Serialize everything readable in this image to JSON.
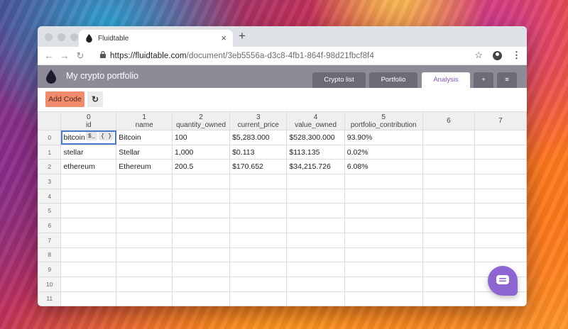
{
  "browser": {
    "tab_title": "Fluidtable",
    "tab_close": "×",
    "new_tab": "+",
    "url_domain": "https://fluidtable.com",
    "url_path": "/document/3eb5556a-d3c8-4fb1-864f-98d21fbcf8f4"
  },
  "app": {
    "title": "My crypto portfolio",
    "tabs": [
      {
        "label": "Crypto list"
      },
      {
        "label": "Portfolio"
      },
      {
        "label": "Analysis"
      },
      {
        "label": "+"
      },
      {
        "label": "≡"
      }
    ],
    "active_tab": "Analysis",
    "add_code_label": "Add Code",
    "refresh_icon": "↻"
  },
  "grid": {
    "columns": [
      {
        "num": "0",
        "name": "id"
      },
      {
        "num": "1",
        "name": "name"
      },
      {
        "num": "2",
        "name": "quantity_owned"
      },
      {
        "num": "3",
        "name": "current_price"
      },
      {
        "num": "4",
        "name": "value_owned"
      },
      {
        "num": "5",
        "name": "portfolio_contribution"
      },
      {
        "num": "6",
        "name": ""
      },
      {
        "num": "7",
        "name": ""
      }
    ],
    "rows": [
      {
        "num": "0",
        "cells": [
          "bitcoin",
          "Bitcoin",
          "100",
          "$5,283.000",
          "$528,300.000",
          "93.90%",
          "",
          ""
        ]
      },
      {
        "num": "1",
        "cells": [
          "stellar",
          "Stellar",
          "1,000",
          "$0.113",
          "$113.135",
          "0.02%",
          "",
          ""
        ]
      },
      {
        "num": "2",
        "cells": [
          "ethereum",
          "Ethereum",
          "200.5",
          "$170.652",
          "$34,215.726",
          "6.08%",
          "",
          ""
        ]
      },
      {
        "num": "3",
        "cells": [
          "",
          "",
          "",
          "",
          "",
          "",
          "",
          ""
        ]
      },
      {
        "num": "4",
        "cells": [
          "",
          "",
          "",
          "",
          "",
          "",
          "",
          ""
        ]
      },
      {
        "num": "5",
        "cells": [
          "",
          "",
          "",
          "",
          "",
          "",
          "",
          ""
        ]
      },
      {
        "num": "6",
        "cells": [
          "",
          "",
          "",
          "",
          "",
          "",
          "",
          ""
        ]
      },
      {
        "num": "7",
        "cells": [
          "",
          "",
          "",
          "",
          "",
          "",
          "",
          ""
        ]
      },
      {
        "num": "8",
        "cells": [
          "",
          "",
          "",
          "",
          "",
          "",
          "",
          ""
        ]
      },
      {
        "num": "9",
        "cells": [
          "",
          "",
          "",
          "",
          "",
          "",
          "",
          ""
        ]
      },
      {
        "num": "10",
        "cells": [
          "",
          "",
          "",
          "",
          "",
          "",
          "",
          ""
        ]
      },
      {
        "num": "11",
        "cells": [
          "",
          "",
          "",
          "",
          "",
          "",
          "",
          ""
        ]
      }
    ],
    "selected_cell_badges": [
      "$_",
      "{ }"
    ]
  },
  "colors": {
    "accent": "#7b56b8",
    "header_bg": "#8e8a98",
    "add_code_bg": "#f28b6b",
    "chat_bg": "#8e66d1"
  }
}
